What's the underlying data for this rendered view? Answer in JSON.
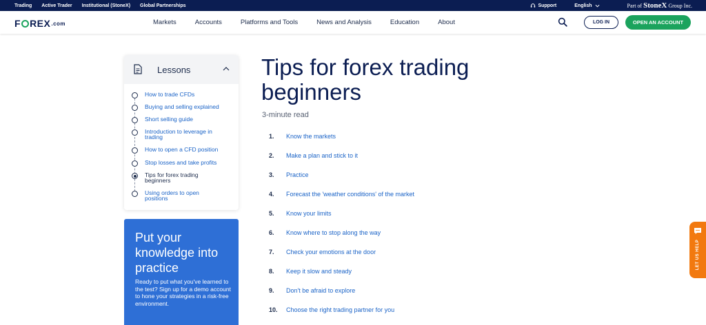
{
  "topbar": {
    "links": [
      "Trading",
      "Active Trader",
      "Institutional (StoneX)",
      "Global Partnerships"
    ],
    "support": "Support",
    "language": "English",
    "partof_prefix": "Part of",
    "partof_brand": "StoneX",
    "partof_suffix": "Group Inc."
  },
  "header": {
    "logo_left": "F",
    "logo_right": "REX",
    "logo_suffix": ".com",
    "nav": [
      "Markets",
      "Accounts",
      "Platforms and Tools",
      "News and Analysis",
      "Education",
      "About"
    ],
    "login": "LOG IN",
    "open_account": "OPEN AN ACCOUNT"
  },
  "lessons": {
    "title": "Lessons",
    "items": [
      {
        "label_lines": [
          "How to trade CFDs"
        ],
        "active": false
      },
      {
        "label_lines": [
          "Buying and selling explained"
        ],
        "active": false
      },
      {
        "label_lines": [
          "Short selling guide"
        ],
        "active": false
      },
      {
        "label_lines": [
          "Introduction to leverage in",
          "trading"
        ],
        "active": false
      },
      {
        "label_lines": [
          "How to open a CFD position"
        ],
        "active": false
      },
      {
        "label_lines": [
          "Stop losses and take profits"
        ],
        "active": false
      },
      {
        "label_lines": [
          "Tips for forex trading",
          "beginners"
        ],
        "active": true
      },
      {
        "label_lines": [
          "Using orders to open",
          "positions"
        ],
        "active": false
      }
    ]
  },
  "promo": {
    "title": "Put your knowledge into practice",
    "text": "Ready to put what you've learned to the test? Sign up for a demo account to hone your strategies in a risk-free environment."
  },
  "article": {
    "title": "Tips for forex trading beginners",
    "read_time": "3-minute read",
    "tips": [
      {
        "num": "1.",
        "text": "Know the markets"
      },
      {
        "num": "2.",
        "text": "Make a plan and stick to it"
      },
      {
        "num": "3.",
        "text": "Practice"
      },
      {
        "num": "4.",
        "text": "Forecast the 'weather conditions' of the market"
      },
      {
        "num": "5.",
        "text": "Know your limits"
      },
      {
        "num": "6.",
        "text": "Know where to stop along the way"
      },
      {
        "num": "7.",
        "text": "Check your emotions at the door"
      },
      {
        "num": "8.",
        "text": "Keep it slow and steady"
      },
      {
        "num": "9.",
        "text": "Don't be afraid to explore"
      },
      {
        "num": "10.",
        "text": "Choose the right trading partner for you"
      }
    ]
  },
  "help": {
    "label": "LET US HELP"
  },
  "colors": {
    "navy": "#0b1d52",
    "green": "#1ba35d",
    "link_blue": "#1a63c7",
    "promo_blue": "#2e6fd6",
    "help_orange": "#f2790f"
  }
}
